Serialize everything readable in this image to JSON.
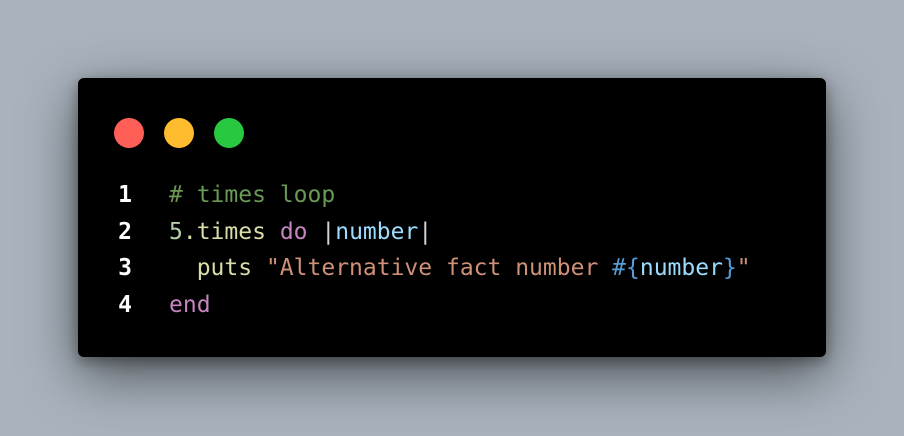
{
  "colors": {
    "background": "#a9b3bd",
    "window": "#000000",
    "dot_close": "#ff5f57",
    "dot_minimize": "#febc2e",
    "dot_maximize": "#28c840",
    "line_number": "#ffffff",
    "comment": "#6a9955",
    "number_literal": "#b5cea8",
    "method": "#dcdcaa",
    "keyword": "#c586c0",
    "punctuation": "#d4d4d4",
    "variable": "#9cdcfe",
    "string": "#ce9178",
    "interpolation": "#569cd6"
  },
  "window_controls": [
    "close",
    "minimize",
    "maximize"
  ],
  "code": {
    "lines": [
      {
        "number": "1",
        "tokens": [
          {
            "text": "# times loop",
            "kind": "comment"
          }
        ]
      },
      {
        "number": "2",
        "tokens": [
          {
            "text": "5",
            "kind": "number_literal"
          },
          {
            "text": ".times",
            "kind": "method"
          },
          {
            "text": " ",
            "kind": "punctuation"
          },
          {
            "text": "do",
            "kind": "keyword"
          },
          {
            "text": " |",
            "kind": "punctuation"
          },
          {
            "text": "number",
            "kind": "variable"
          },
          {
            "text": "|",
            "kind": "punctuation"
          }
        ]
      },
      {
        "number": "3",
        "tokens": [
          {
            "text": "  ",
            "kind": "punctuation"
          },
          {
            "text": "puts",
            "kind": "method"
          },
          {
            "text": " ",
            "kind": "punctuation"
          },
          {
            "text": "\"Alternative fact number ",
            "kind": "string"
          },
          {
            "text": "#{",
            "kind": "interpolation"
          },
          {
            "text": "number",
            "kind": "variable"
          },
          {
            "text": "}",
            "kind": "interpolation"
          },
          {
            "text": "\"",
            "kind": "string"
          }
        ]
      },
      {
        "number": "4",
        "tokens": [
          {
            "text": "end",
            "kind": "keyword"
          }
        ]
      }
    ]
  }
}
